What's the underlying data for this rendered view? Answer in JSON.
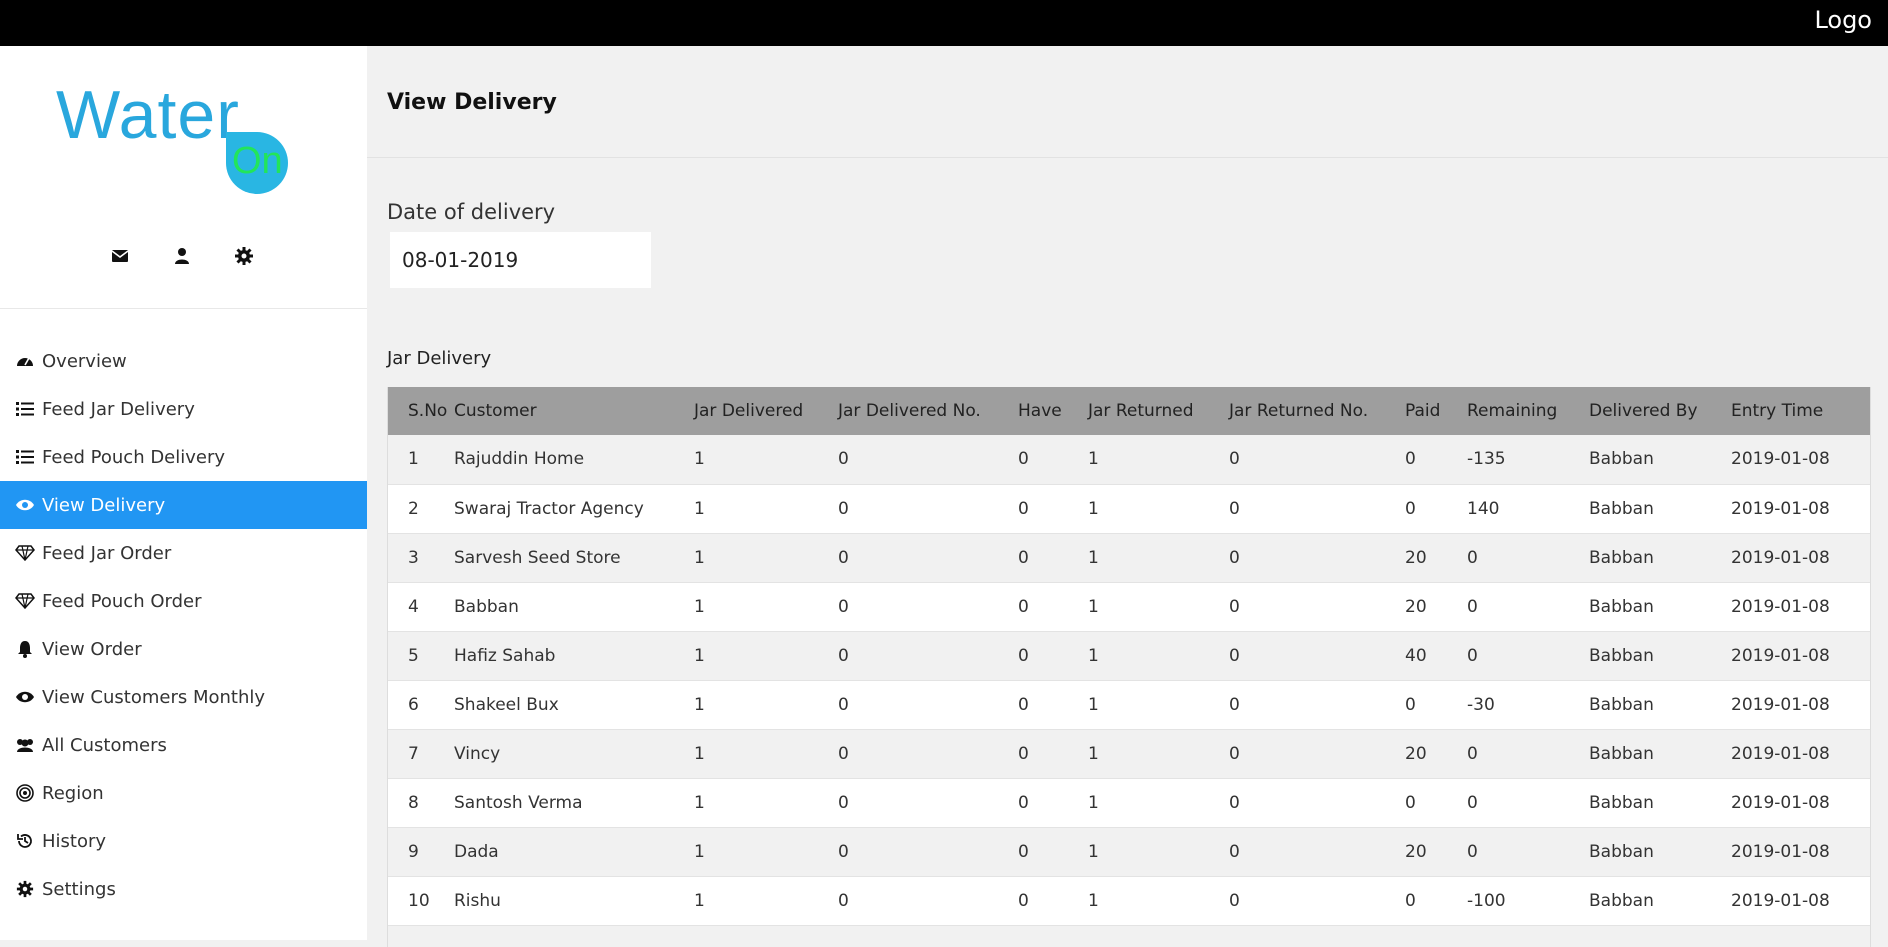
{
  "topbar": {
    "logo_text": "Logo"
  },
  "brand": {
    "word1": "Water",
    "word2": "On"
  },
  "sidebar_icons": [
    "envelope-icon",
    "user-icon",
    "gear-icon"
  ],
  "nav": [
    {
      "label": "Overview",
      "icon": "dashboard-icon",
      "active": false
    },
    {
      "label": "Feed Jar Delivery",
      "icon": "list-icon",
      "active": false
    },
    {
      "label": "Feed Pouch Delivery",
      "icon": "list-icon",
      "active": false
    },
    {
      "label": "View Delivery",
      "icon": "eye-icon",
      "active": true
    },
    {
      "label": "Feed Jar Order",
      "icon": "diamond-icon",
      "active": false
    },
    {
      "label": "Feed Pouch Order",
      "icon": "diamond-icon",
      "active": false
    },
    {
      "label": "View Order",
      "icon": "bell-icon",
      "active": false
    },
    {
      "label": "View Customers Monthly",
      "icon": "eye-icon",
      "active": false
    },
    {
      "label": "All Customers",
      "icon": "users-icon",
      "active": false
    },
    {
      "label": "Region",
      "icon": "bullseye-icon",
      "active": false
    },
    {
      "label": "History",
      "icon": "history-icon",
      "active": false
    },
    {
      "label": "Settings",
      "icon": "gear-icon",
      "active": false
    }
  ],
  "page": {
    "title": "View Delivery",
    "date_label": "Date of delivery",
    "date_value": "08-01-2019",
    "section_title": "Jar Delivery"
  },
  "table": {
    "headers": [
      "S.No",
      "Customer",
      "Jar Delivered",
      "Jar Delivered No.",
      "Have",
      "Jar Returned",
      "Jar Returned No.",
      "Paid",
      "Remaining",
      "Delivered By",
      "Entry Time"
    ],
    "rows": [
      [
        "1",
        "Rajuddin Home",
        "1",
        "0",
        "0",
        "1",
        "0",
        "0",
        "-135",
        "Babban",
        "2019-01-08"
      ],
      [
        "2",
        "Swaraj Tractor Agency",
        "1",
        "0",
        "0",
        "1",
        "0",
        "0",
        "140",
        "Babban",
        "2019-01-08"
      ],
      [
        "3",
        "Sarvesh Seed Store",
        "1",
        "0",
        "0",
        "1",
        "0",
        "20",
        "0",
        "Babban",
        "2019-01-08"
      ],
      [
        "4",
        "Babban",
        "1",
        "0",
        "0",
        "1",
        "0",
        "20",
        "0",
        "Babban",
        "2019-01-08"
      ],
      [
        "5",
        "Hafiz Sahab",
        "1",
        "0",
        "0",
        "1",
        "0",
        "40",
        "0",
        "Babban",
        "2019-01-08"
      ],
      [
        "6",
        "Shakeel Bux",
        "1",
        "0",
        "0",
        "1",
        "0",
        "0",
        "-30",
        "Babban",
        "2019-01-08"
      ],
      [
        "7",
        "Vincy",
        "1",
        "0",
        "0",
        "1",
        "0",
        "20",
        "0",
        "Babban",
        "2019-01-08"
      ],
      [
        "8",
        "Santosh Verma",
        "1",
        "0",
        "0",
        "1",
        "0",
        "0",
        "0",
        "Babban",
        "2019-01-08"
      ],
      [
        "9",
        "Dada",
        "1",
        "0",
        "0",
        "1",
        "0",
        "20",
        "0",
        "Babban",
        "2019-01-08"
      ],
      [
        "10",
        "Rishu",
        "1",
        "0",
        "0",
        "1",
        "0",
        "0",
        "-100",
        "Babban",
        "2019-01-08"
      ]
    ]
  },
  "colors": {
    "active": "#2196f3",
    "brand": "#29a7dd",
    "brand_on": "#22e55a",
    "header": "#9e9e9e"
  }
}
